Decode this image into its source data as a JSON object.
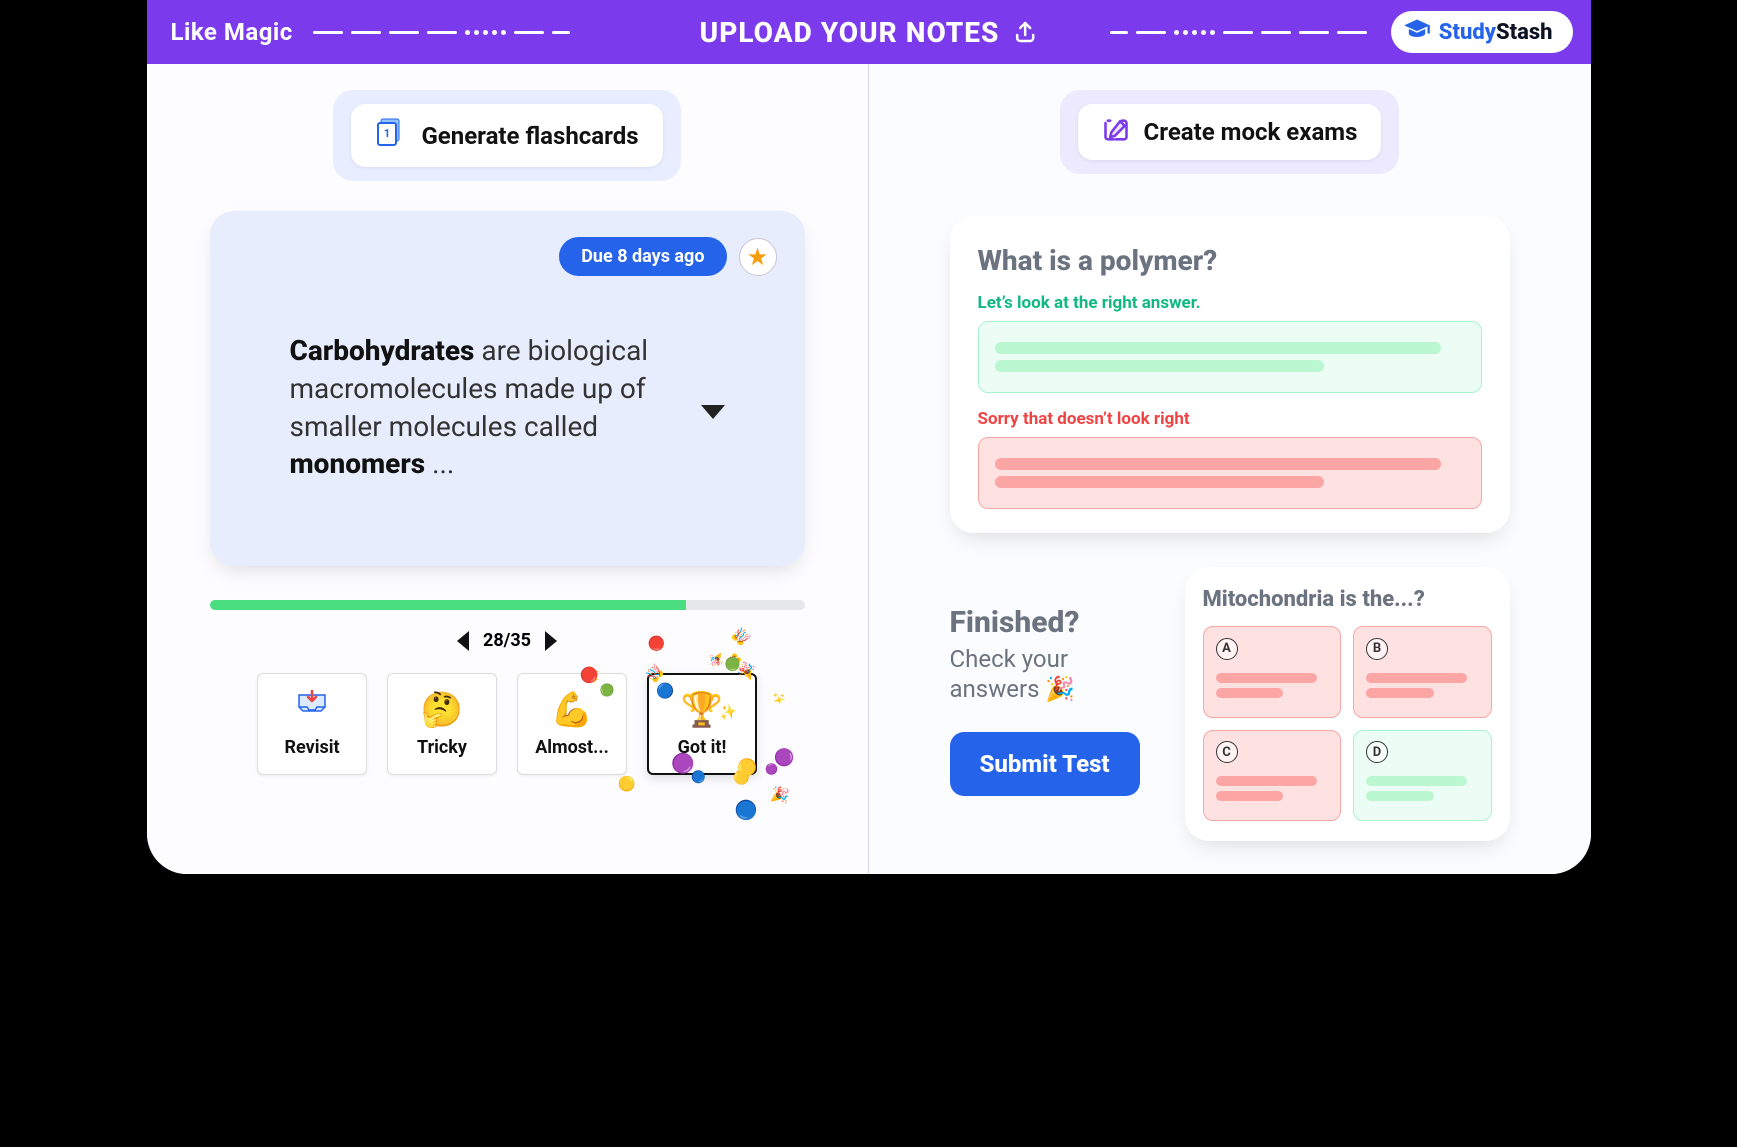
{
  "banner": {
    "left_text": "Like Magic",
    "center_text": "UPLOAD YOUR NOTES",
    "brand_study": "Study",
    "brand_stash": "Stash"
  },
  "left": {
    "generate_label": "Generate flashcards",
    "due_label": "Due 8 days ago",
    "card_html": [
      "Carbohydrates",
      " are biological macromolecules made up of smaller molecules called ",
      "monomers",
      " ..."
    ],
    "progress_percent": 80,
    "current_index": 28,
    "total_cards": 35,
    "ratings": [
      {
        "key": "revisit",
        "label": "Revisit",
        "emoji": "📥"
      },
      {
        "key": "tricky",
        "label": "Tricky",
        "emoji": "🤔"
      },
      {
        "key": "almost",
        "label": "Almost...",
        "emoji": "💪"
      },
      {
        "key": "gotit",
        "label": "Got it!",
        "emoji": "🏆",
        "highlight": true
      }
    ]
  },
  "right": {
    "create_label": "Create mock exams",
    "q1_title": "What is a polymer?",
    "q1_good": "Let’s look at the right answer.",
    "q1_bad": "Sorry that doesn’t look right",
    "finished_title": "Finished?",
    "finished_sub": "Check your answers 🎉",
    "submit_label": "Submit Test",
    "mito_title": "Mitochondria is the...?",
    "options": [
      {
        "letter": "A",
        "state": "red"
      },
      {
        "letter": "B",
        "state": "red"
      },
      {
        "letter": "C",
        "state": "red"
      },
      {
        "letter": "D",
        "state": "green"
      }
    ]
  }
}
